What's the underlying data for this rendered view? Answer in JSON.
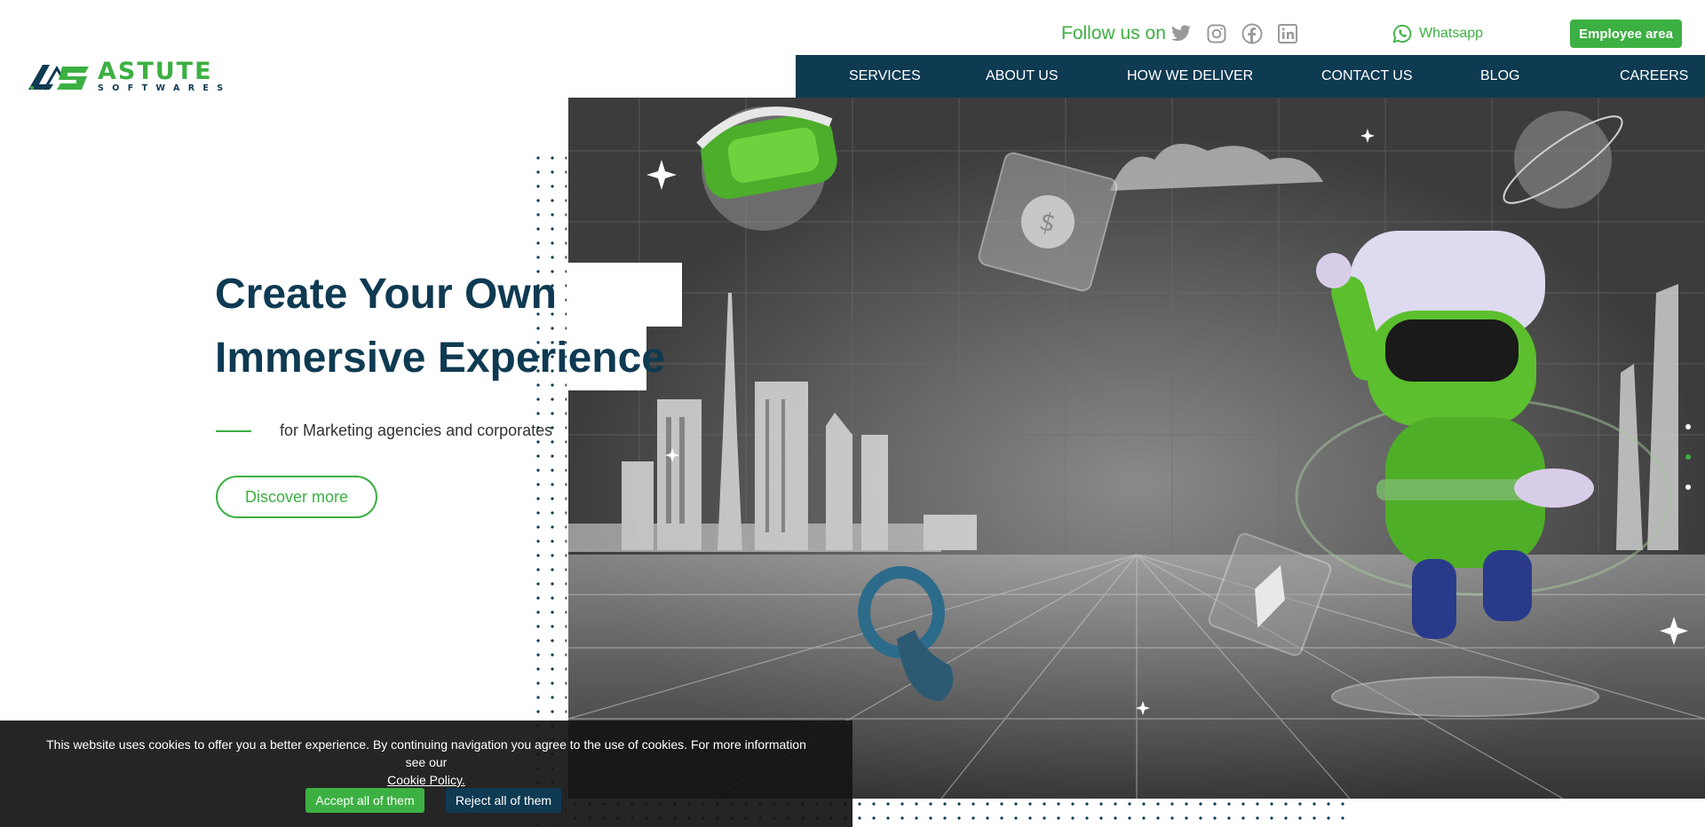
{
  "brand": {
    "name": "ASTUTE",
    "tagline": "SOFTWARES",
    "green": "#3cb042",
    "navy": "#0e3a52"
  },
  "topbar": {
    "follow_label": "Follow us on",
    "social_icons": [
      "twitter-icon",
      "instagram-icon",
      "facebook-icon",
      "linkedin-icon"
    ],
    "whatsapp_label": "Whatsapp",
    "employee_label": "Employee area"
  },
  "nav": {
    "items": [
      {
        "label": "SERVICES"
      },
      {
        "label": "ABOUT US"
      },
      {
        "label": "HOW WE DELIVER"
      },
      {
        "label": "CONTACT US"
      },
      {
        "label": "BLOG"
      },
      {
        "label": "CAREERS"
      }
    ]
  },
  "hero": {
    "title_line1": "Create Your Own",
    "title_line2": "Immersive Experience",
    "subtitle": "for Marketing agencies and corporates",
    "cta_label": "Discover more"
  },
  "cookie": {
    "message": "This website uses cookies to offer you a better experience. By continuing navigation you agree to the use of cookies. For more information see our",
    "link_label": "Cookie Policy.",
    "accept_label": "Accept all of them",
    "reject_label": "Reject all of them"
  }
}
